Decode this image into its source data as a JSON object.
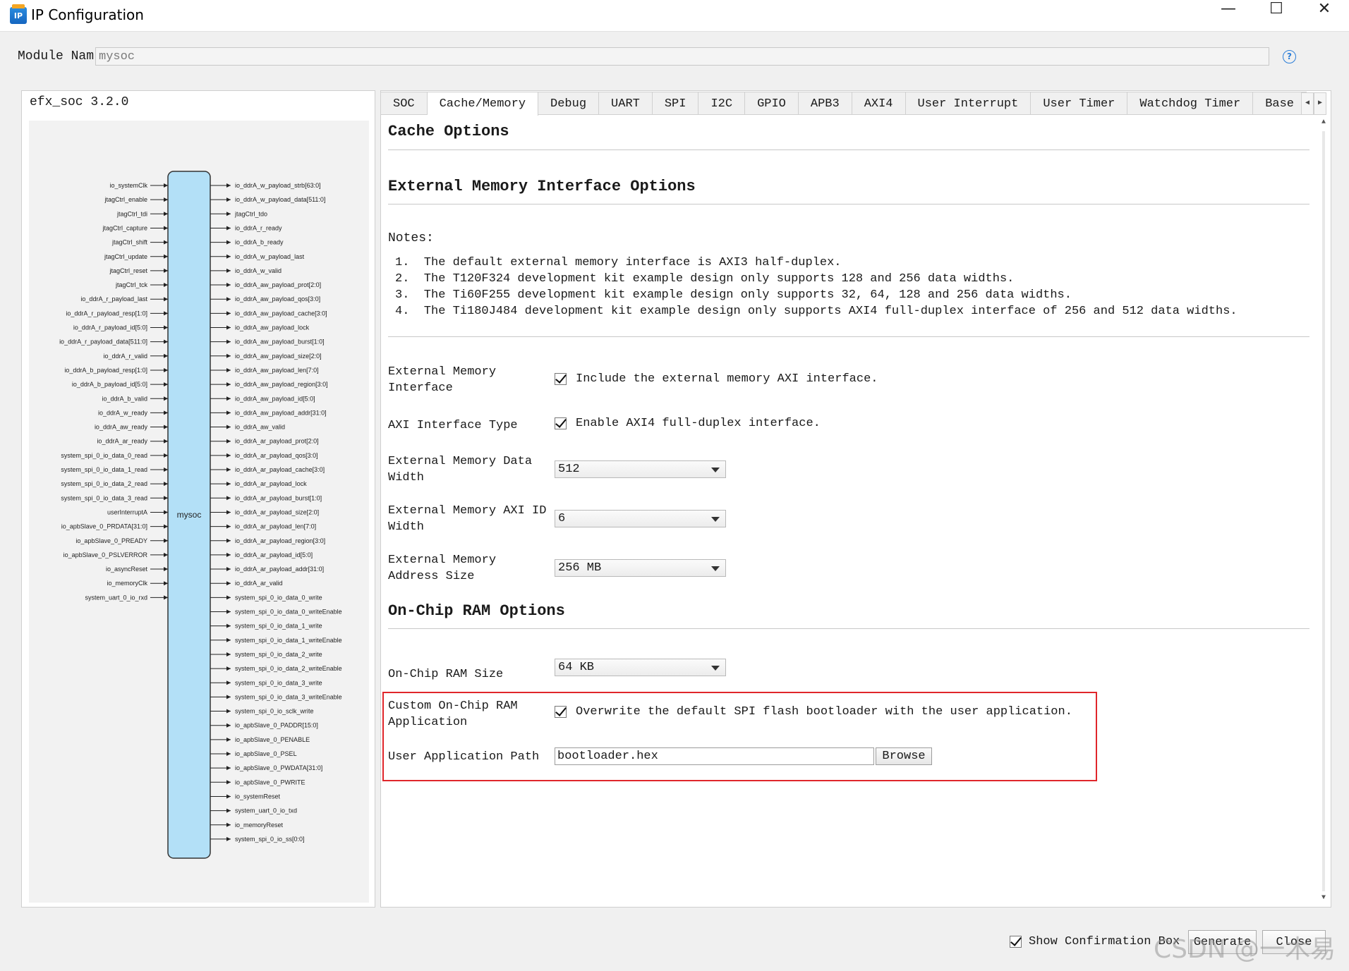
{
  "window": {
    "title": "IP Configuration",
    "minimize_icon": "minimize-icon",
    "maximize_icon": "maximize-icon",
    "close_icon": "close-icon"
  },
  "module": {
    "label": "Module Nam",
    "value": "mysoc",
    "help_icon": "help-icon"
  },
  "left": {
    "version": "efx_soc 3.2.0",
    "block_label": "mysoc",
    "inputs": [
      "io_systemClk",
      "jtagCtrl_enable",
      "jtagCtrl_tdi",
      "jtagCtrl_capture",
      "jtagCtrl_shift",
      "jtagCtrl_update",
      "jtagCtrl_reset",
      "jtagCtrl_tck",
      "io_ddrA_r_payload_last",
      "io_ddrA_r_payload_resp[1:0]",
      "io_ddrA_r_payload_id[5:0]",
      "io_ddrA_r_payload_data[511:0]",
      "io_ddrA_r_valid",
      "io_ddrA_b_payload_resp[1:0]",
      "io_ddrA_b_payload_id[5:0]",
      "io_ddrA_b_valid",
      "io_ddrA_w_ready",
      "io_ddrA_aw_ready",
      "io_ddrA_ar_ready",
      "system_spi_0_io_data_0_read",
      "system_spi_0_io_data_1_read",
      "system_spi_0_io_data_2_read",
      "system_spi_0_io_data_3_read",
      "userInterruptA",
      "io_apbSlave_0_PRDATA[31:0]",
      "io_apbSlave_0_PREADY",
      "io_apbSlave_0_PSLVERROR",
      "io_asyncReset",
      "io_memoryClk",
      "system_uart_0_io_rxd"
    ],
    "outputs": [
      "io_ddrA_w_payload_strb[63:0]",
      "io_ddrA_w_payload_data[511:0]",
      "jtagCtrl_tdo",
      "io_ddrA_r_ready",
      "io_ddrA_b_ready",
      "io_ddrA_w_payload_last",
      "io_ddrA_w_valid",
      "io_ddrA_aw_payload_prot[2:0]",
      "io_ddrA_aw_payload_qos[3:0]",
      "io_ddrA_aw_payload_cache[3:0]",
      "io_ddrA_aw_payload_lock",
      "io_ddrA_aw_payload_burst[1:0]",
      "io_ddrA_aw_payload_size[2:0]",
      "io_ddrA_aw_payload_len[7:0]",
      "io_ddrA_aw_payload_region[3:0]",
      "io_ddrA_aw_payload_id[5:0]",
      "io_ddrA_aw_payload_addr[31:0]",
      "io_ddrA_aw_valid",
      "io_ddrA_ar_payload_prot[2:0]",
      "io_ddrA_ar_payload_qos[3:0]",
      "io_ddrA_ar_payload_cache[3:0]",
      "io_ddrA_ar_payload_lock",
      "io_ddrA_ar_payload_burst[1:0]",
      "io_ddrA_ar_payload_size[2:0]",
      "io_ddrA_ar_payload_len[7:0]",
      "io_ddrA_ar_payload_region[3:0]",
      "io_ddrA_ar_payload_id[5:0]",
      "io_ddrA_ar_payload_addr[31:0]",
      "io_ddrA_ar_valid",
      "system_spi_0_io_data_0_write",
      "system_spi_0_io_data_0_writeEnable",
      "system_spi_0_io_data_1_write",
      "system_spi_0_io_data_1_writeEnable",
      "system_spi_0_io_data_2_write",
      "system_spi_0_io_data_2_writeEnable",
      "system_spi_0_io_data_3_write",
      "system_spi_0_io_data_3_writeEnable",
      "system_spi_0_io_sclk_write",
      "io_apbSlave_0_PADDR[15:0]",
      "io_apbSlave_0_PENABLE",
      "io_apbSlave_0_PSEL",
      "io_apbSlave_0_PWDATA[31:0]",
      "io_apbSlave_0_PWRITE",
      "io_systemReset",
      "system_uart_0_io_txd",
      "io_memoryReset",
      "system_spi_0_io_ss[0:0]"
    ]
  },
  "tabs": [
    {
      "label": "SOC"
    },
    {
      "label": "Cache/Memory",
      "active": true
    },
    {
      "label": "Debug"
    },
    {
      "label": "UART"
    },
    {
      "label": "SPI"
    },
    {
      "label": "I2C"
    },
    {
      "label": "GPIO"
    },
    {
      "label": "APB3"
    },
    {
      "label": "AXI4"
    },
    {
      "label": "User Interrupt"
    },
    {
      "label": "User Timer"
    },
    {
      "label": "Watchdog Timer"
    },
    {
      "label": "Base"
    }
  ],
  "cache": {
    "section_title": "Cache Options"
  },
  "ext_mem": {
    "section_title": "External Memory Interface Options",
    "notes_title": "Notes:",
    "notes": [
      "1.  The default external memory interface is AXI3 half-duplex.",
      "2.  The T120F324 development kit example design only supports 128 and 256 data widths.",
      "3.  The Ti60F255 development kit example design only supports 32, 64, 128 and 256 data widths.",
      "4.  The Ti180J484 development kit example design only supports AXI4 full-duplex interface of 256 and 512 data widths."
    ],
    "interface_label": "External Memory Interface",
    "interface_check": "Include the external memory AXI interface.",
    "interface_checked": true,
    "axi_type_label": "AXI Interface Type",
    "axi_type_check": "Enable AXI4 full-duplex interface.",
    "axi_type_checked": true,
    "data_width_label": "External Memory Data Width",
    "data_width_value": "512",
    "axi_id_label": "External Memory AXI ID Width",
    "axi_id_value": "6",
    "addr_size_label": "External Memory Address Size",
    "addr_size_value": "256 MB"
  },
  "onchip": {
    "section_title": "On-Chip RAM Options",
    "ram_size_label": "On-Chip RAM Size",
    "ram_size_value": "64 KB",
    "custom_label": "Custom On-Chip RAM Application",
    "custom_check": "Overwrite the default SPI flash bootloader with the user application.",
    "custom_checked": true,
    "path_label": "User Application Path",
    "path_value": "bootloader.hex",
    "browse_label": "Browse"
  },
  "footer": {
    "confirm_label": "Show Confirmation Box",
    "confirm_checked": true,
    "generate_label": "Generate",
    "close_label": "Close",
    "watermark": "CSDN @一木易"
  },
  "colors": {
    "highlight_border": "#e0262b",
    "block_fill": "#b3e0f7",
    "accent": "#2b7ed8"
  }
}
